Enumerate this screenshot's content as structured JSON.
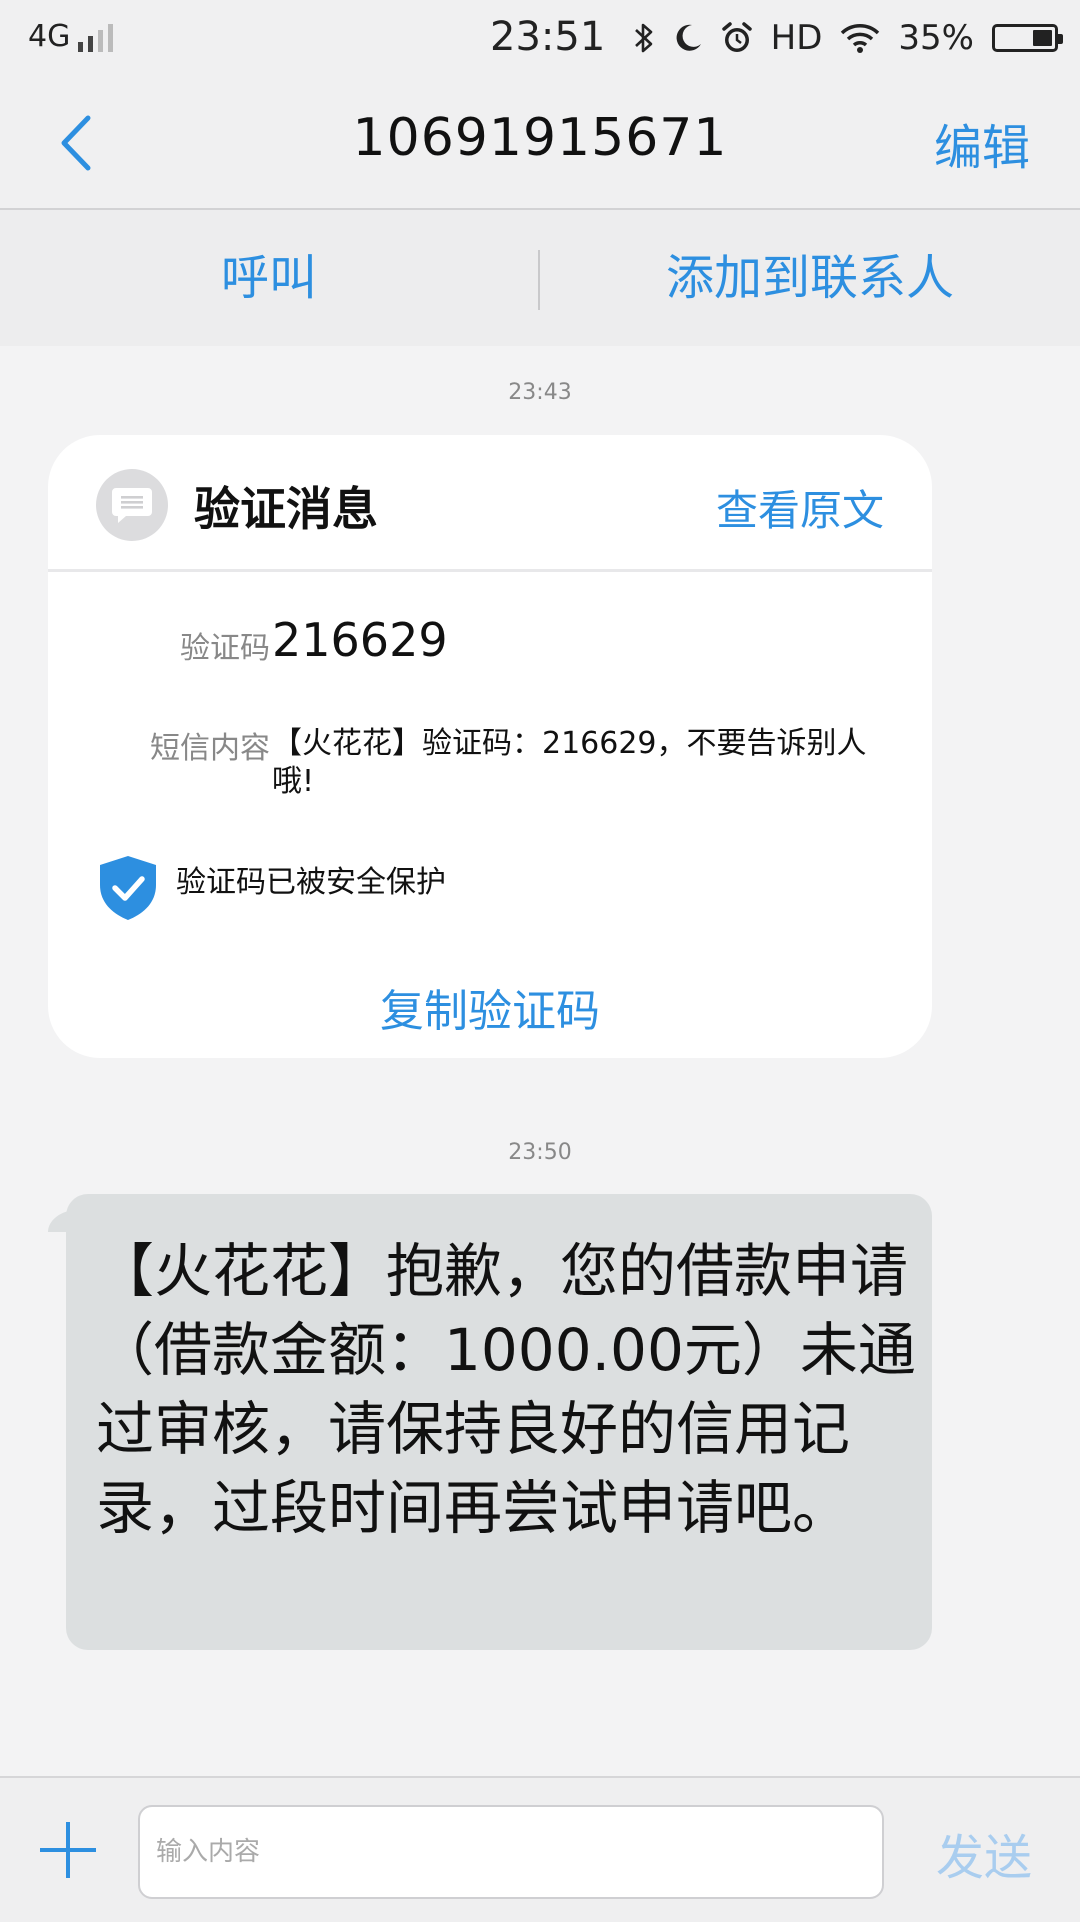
{
  "status_bar": {
    "network": "4G",
    "time": "23:51",
    "hd": "HD",
    "battery_percent_label": "35%",
    "battery_level": 0.35,
    "icons": [
      "signal-icon",
      "bluetooth-icon",
      "moon-icon",
      "alarm-icon",
      "wifi-icon",
      "battery-icon"
    ]
  },
  "header": {
    "title": "10691915671",
    "edit_label": "编辑",
    "back_icon": "chevron-left-icon"
  },
  "actions": {
    "call_label": "呼叫",
    "add_contact_label": "添加到联系人"
  },
  "messages": {
    "card_timestamp": "23:43",
    "card": {
      "title": "验证消息",
      "view_original_label": "查看原文",
      "code_label": "验证码",
      "code_value": "216629",
      "content_label": "短信内容",
      "content_value": "【火花花】验证码：216629，不要告诉别人哦!",
      "protected_text": "验证码已被安全保护",
      "copy_label": "复制验证码"
    },
    "bubble_timestamp": "23:50",
    "bubble_text": "【火花花】抱歉，您的借款申请（借款金额：1000.00元）未通过审核，请保持良好的信用记录，过段时间再尝试申请吧。"
  },
  "input_bar": {
    "placeholder": "输入内容",
    "value": "",
    "send_label": "发送"
  },
  "colors": {
    "accent": "#2d8fe0",
    "send_disabled": "#a9cdef",
    "bubble": "#dcdfe0",
    "background": "#f3f3f4"
  }
}
